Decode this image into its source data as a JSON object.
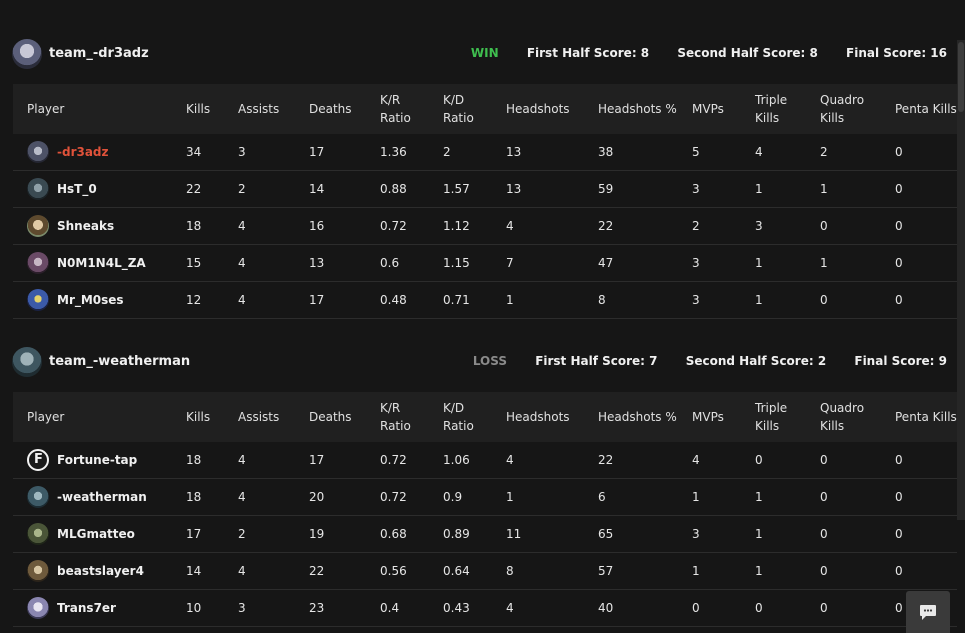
{
  "columns": [
    "Player",
    "Kills",
    "Assists",
    "Deaths",
    "K/R Ratio",
    "K/D Ratio",
    "Headshots",
    "Headshots %",
    "MVPs",
    "Triple Kills",
    "Quadro Kills",
    "Penta Kills"
  ],
  "team1": {
    "name": "team_-dr3adz",
    "result": "WIN",
    "first_half": "First Half Score: 8",
    "second_half": "Second Half Score: 8",
    "final": "Final Score: 16",
    "players": [
      {
        "name": "-dr3adz",
        "highlight": true,
        "stats": [
          "34",
          "3",
          "17",
          "1.36",
          "2",
          "13",
          "38",
          "5",
          "4",
          "2",
          "0"
        ]
      },
      {
        "name": "HsT_0",
        "stats": [
          "22",
          "2",
          "14",
          "0.88",
          "1.57",
          "13",
          "59",
          "3",
          "1",
          "1",
          "0"
        ]
      },
      {
        "name": "Shneaks",
        "stats": [
          "18",
          "4",
          "16",
          "0.72",
          "1.12",
          "4",
          "22",
          "2",
          "3",
          "0",
          "0"
        ]
      },
      {
        "name": "N0M1N4L_ZA",
        "stats": [
          "15",
          "4",
          "13",
          "0.6",
          "1.15",
          "7",
          "47",
          "3",
          "1",
          "1",
          "0"
        ]
      },
      {
        "name": "Mr_M0ses",
        "stats": [
          "12",
          "4",
          "17",
          "0.48",
          "0.71",
          "1",
          "8",
          "3",
          "1",
          "0",
          "0"
        ]
      }
    ]
  },
  "team2": {
    "name": "team_-weatherman",
    "result": "LOSS",
    "first_half": "First Half Score: 7",
    "second_half": "Second Half Score: 2",
    "final": "Final Score: 9",
    "players": [
      {
        "name": "Fortune-tap",
        "stats": [
          "18",
          "4",
          "17",
          "0.72",
          "1.06",
          "4",
          "22",
          "4",
          "0",
          "0",
          "0"
        ]
      },
      {
        "name": "-weatherman",
        "stats": [
          "18",
          "4",
          "20",
          "0.72",
          "0.9",
          "1",
          "6",
          "1",
          "1",
          "0",
          "0"
        ]
      },
      {
        "name": "MLGmatteo",
        "stats": [
          "17",
          "2",
          "19",
          "0.68",
          "0.89",
          "11",
          "65",
          "3",
          "1",
          "0",
          "0"
        ]
      },
      {
        "name": "beastslayer4",
        "stats": [
          "14",
          "4",
          "22",
          "0.56",
          "0.64",
          "8",
          "57",
          "1",
          "1",
          "0",
          "0"
        ]
      },
      {
        "name": "Trans7er",
        "stats": [
          "10",
          "3",
          "23",
          "0.4",
          "0.43",
          "4",
          "40",
          "0",
          "0",
          "0",
          "0"
        ]
      }
    ]
  },
  "colors": {
    "win": "#3fbf4f",
    "loss": "#8a8a8a",
    "highlight": "#e0523a",
    "background": "#161616"
  },
  "icons": {
    "chat": "chat-bubble-icon"
  }
}
